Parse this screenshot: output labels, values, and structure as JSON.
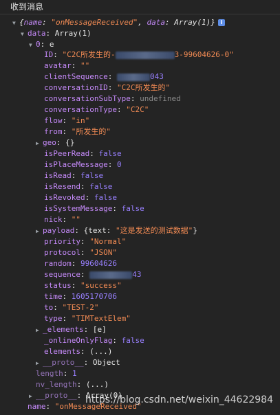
{
  "header": {
    "title": "收到消息"
  },
  "root": {
    "summary_name_key": "name",
    "summary_name_val": "\"onMessageReceived\"",
    "summary_data_key": "data",
    "summary_data_val": "Array(1)"
  },
  "data": {
    "key": "data",
    "val": "Array(1)"
  },
  "item0": {
    "key": "0",
    "val": "e"
  },
  "fields": {
    "ID": "\"C2C所发生的-",
    "ID_tail": "3-99604626-0\"",
    "avatar": "\"\"",
    "clientSequence_tail": "043",
    "conversationID": "\"C2C所发生的\"",
    "conversationSubType": "undefined",
    "conversationType": "\"C2C\"",
    "flow": "\"in\"",
    "from": "\"所发生的\"",
    "geo": "{}",
    "isPeerRead": "false",
    "isPlaceMessage": "0",
    "isRead": "false",
    "isResend": "false",
    "isRevoked": "false",
    "isSystemMessage": "false",
    "nick": "\"\"",
    "payload_pre": "{text: ",
    "payload_text": "\"这是发送的测试数据\"",
    "payload_post": "}",
    "priority": "\"Normal\"",
    "protocol": "\"JSON\"",
    "random": "99604626",
    "sequence_tail": "43",
    "status": "\"success\"",
    "time": "1605170706",
    "to": "\"TEST-2\"",
    "type": "\"TIMTextElem\"",
    "_elements": "[e]",
    "_onlineOnlyFlag": "false",
    "elements": "(...)",
    "__proto__": "Object"
  },
  "tail": {
    "length_key": "length",
    "length_val": "1",
    "nv_length_key": "nv_length",
    "nv_length_val": "(...)",
    "proto_key": "__proto__",
    "proto_val": "Array(0)",
    "name_key": "name",
    "name_val": "\"onMessageReceived\""
  },
  "watermark": "https://blog.csdn.net/weixin_44622984"
}
